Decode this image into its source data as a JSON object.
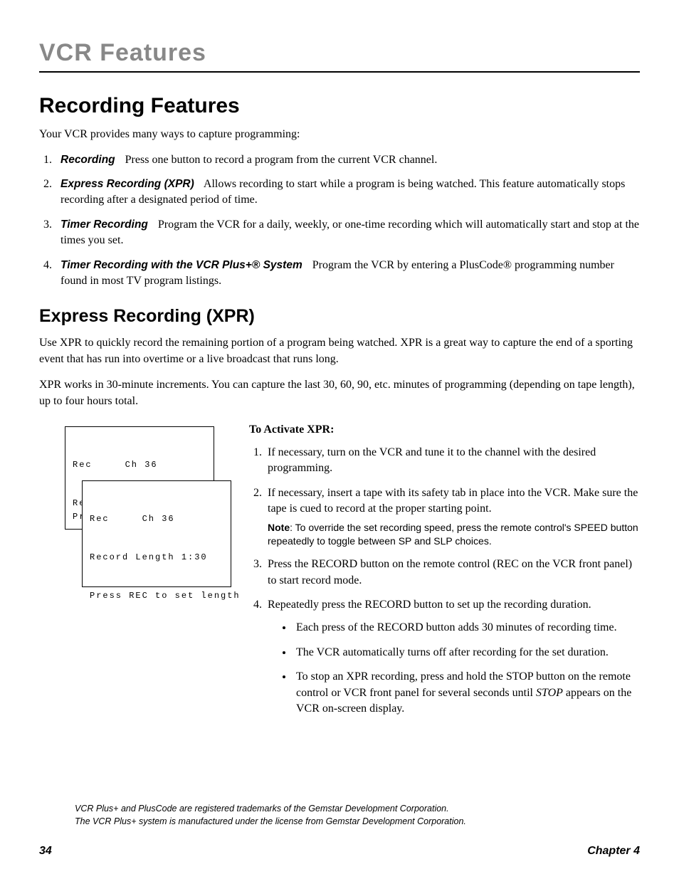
{
  "chapter_title": "VCR Features",
  "h1": "Recording Features",
  "intro": "Your VCR provides many ways to capture programming:",
  "features": [
    {
      "label": "Recording",
      "desc": "Press one button to record a program from the current VCR channel."
    },
    {
      "label": "Express Recording (XPR)",
      "desc": "Allows recording to start while a program is being watched. This feature automatically stops recording after a designated period of time."
    },
    {
      "label": "Timer Recording",
      "desc": "Program the VCR for a daily, weekly, or one-time recording which will automatically start and stop at the times you set."
    },
    {
      "label": "Timer Recording with the VCR Plus+® System",
      "desc": "Program the VCR by entering a PlusCode® programming number found in most TV program listings."
    }
  ],
  "h2": "Express Recording (XPR)",
  "xpr_p1": "Use XPR to quickly record the remaining portion of a program being watched. XPR is a great way to capture the end of a sporting event that has run into overtime or a live broadcast that runs long.",
  "xpr_p2": "XPR works in 30-minute increments. You can capture the last 30, 60, 90, etc. minutes of programming (depending on tape length), up to four hours total.",
  "osd1_line1": "Rec     Ch 36",
  "osd1_line2": "Record Length 0:00",
  "osd1_line3": "Pr",
  "osd2_line1": "Rec     Ch 36",
  "osd2_line2": "Record Length 1:30",
  "osd2_line3": "Press REC to set length",
  "activate_heading": "To Activate XPR:",
  "steps": {
    "s1": "If necessary, turn on the VCR and tune it to the channel with the desired programming.",
    "s2": "If necessary, insert a tape with its safety tab in place into the VCR. Make sure the tape is cued to record at the proper starting point.",
    "s3": "Press the RECORD button on the remote control (REC on the VCR front panel) to start record mode.",
    "s4": "Repeatedly press the RECORD button to set up the recording duration."
  },
  "note_label": "Note",
  "note_text": ": To override the set recording speed, press the remote control's SPEED button repeatedly to toggle between SP and SLP choices.",
  "bullets": {
    "b1": "Each press of the RECORD button adds 30 minutes of recording time.",
    "b2": "The VCR automatically turns off after recording for the set duration.",
    "b3_pre": "To stop an XPR recording, press and hold the STOP button on the remote control or VCR front panel for several seconds until ",
    "b3_em": "STOP",
    "b3_post": " appears on the VCR on-screen display."
  },
  "footnote1": "VCR Plus+ and PlusCode are registered trademarks of the Gemstar Development Corporation.",
  "footnote2": "The VCR Plus+ system is manufactured under the license from Gemstar Development Corporation.",
  "page_number": "34",
  "chapter_label": "Chapter 4"
}
